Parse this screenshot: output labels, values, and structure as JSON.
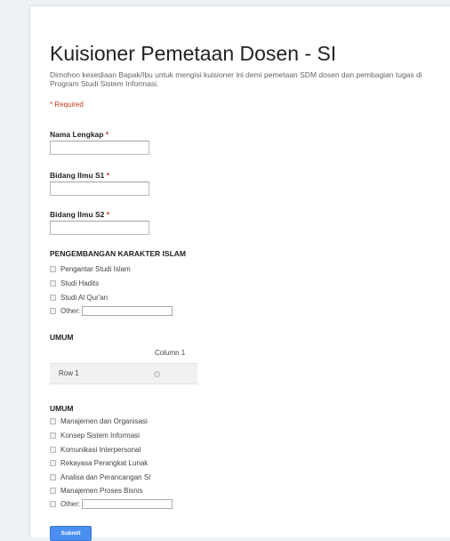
{
  "form": {
    "title": "Kuisioner Pemetaan Dosen - SI",
    "description": "Dimohon kesediaan Bapak/Ibu untuk mengisi kuisioner ini demi pemetaan SDM dosen dan pembagian tugas di Program Studi Sistem Informasi.",
    "required_note": "* Required",
    "star": "*"
  },
  "fields": {
    "nama": "Nama Lengkap",
    "s1": "Bidang Ilmu S1",
    "s2": "Bidang Ilmu S2"
  },
  "section_karakter": {
    "title": "PENGEMBANGAN KARAKTER ISLAM",
    "options": [
      "Pengantar Studi Islam",
      "Studi Hadits",
      "Studi Al Qur'an"
    ],
    "other_label": "Other:"
  },
  "grid": {
    "title": "UMUM",
    "column": "Column 1",
    "row": "Row 1"
  },
  "section_umum": {
    "title": "UMUM",
    "options": [
      "Manajemen dan Organisasi",
      "Konsep Sistem Informasi",
      "Komunikasi Interpersonal",
      "Rekayasa Perangkat Lunak",
      "Analisa dan Perancangan SI",
      "Manajemen Proses Bisnis"
    ],
    "other_label": "Other:"
  },
  "submit_label": "Submit"
}
